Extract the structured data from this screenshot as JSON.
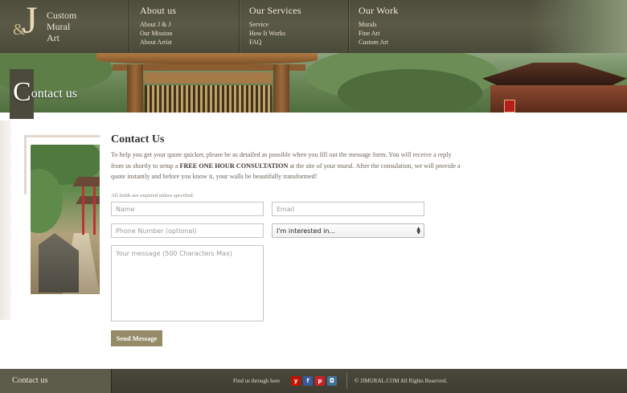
{
  "logo": {
    "amp": "&",
    "letter": "J",
    "line1": "Custom",
    "line2": "Mural",
    "line3": "Art"
  },
  "nav": [
    {
      "heading": "About us",
      "links": [
        "About J & J",
        "Our Mission",
        "About Artist"
      ]
    },
    {
      "heading": "Our Services",
      "links": [
        "Service",
        "How It Works",
        "FAQ"
      ]
    },
    {
      "heading": "Our Work",
      "links": [
        "Murals",
        "Fine Art",
        "Custom Art"
      ]
    }
  ],
  "banner": {
    "title_initial": "C",
    "title_rest": "ontact us"
  },
  "contact": {
    "heading": "Contact Us",
    "intro_part1": "To help you get your quote quicker, please be as detailed as possible when you fill out the message form. You will receive a reply from us shortly to setup a ",
    "intro_bold": "FREE ONE HOUR CONSULTATION",
    "intro_part2": " at the site of your mural. After the consulation, we will provide a quote instantly and before you know it, your walls be beautifully transformed!",
    "required_note": "All fields are required unless specified."
  },
  "form": {
    "name_placeholder": "Name",
    "email_placeholder": "Email",
    "phone_placeholder": "Phone Number (optional)",
    "interest_selected": "I'm interested in...",
    "message_placeholder": "Your message (500 Characters Max)",
    "send_label": "Send Message"
  },
  "footer": {
    "title": "Contact us",
    "find_us": "Find us through here",
    "social": [
      {
        "name": "yelp-icon",
        "glyph": "y",
        "color": "#c41200"
      },
      {
        "name": "facebook-icon",
        "glyph": "f",
        "color": "#3b5998"
      },
      {
        "name": "pinterest-icon",
        "glyph": "p",
        "color": "#cb2027"
      },
      {
        "name": "instagram-icon",
        "glyph": "◘",
        "color": "#3f729b"
      }
    ],
    "copyright": "© JJMURAL.COM All Rights Reserved."
  }
}
